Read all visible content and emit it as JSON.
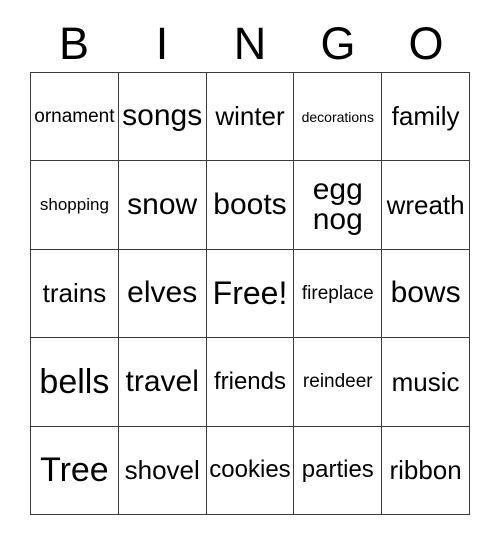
{
  "card": {
    "header": {
      "letters": [
        "B",
        "I",
        "N",
        "G",
        "O"
      ]
    },
    "grid": {
      "columns": 5,
      "rows": 5,
      "border_color": "#3a3a3a",
      "background_color": "#ffffff",
      "text_color": "#000000",
      "cells": [
        {
          "text": "ornament",
          "size": "fs-xs",
          "wrap": false
        },
        {
          "text": "songs",
          "size": "fs-l",
          "wrap": false
        },
        {
          "text": "winter",
          "size": "fs-m",
          "wrap": false
        },
        {
          "text": "decorations",
          "size": "fs-tiny",
          "wrap": false
        },
        {
          "text": "family",
          "size": "fs-m",
          "wrap": false
        },
        {
          "text": "shopping",
          "size": "fs-xxs",
          "wrap": false
        },
        {
          "text": "snow",
          "size": "fs-l",
          "wrap": false
        },
        {
          "text": "boots",
          "size": "fs-l",
          "wrap": false
        },
        {
          "text": "egg nog",
          "size": "fs-l",
          "wrap": true
        },
        {
          "text": "wreath",
          "size": "fs-m",
          "wrap": false
        },
        {
          "text": "trains",
          "size": "fs-m",
          "wrap": false
        },
        {
          "text": "elves",
          "size": "fs-l",
          "wrap": false
        },
        {
          "text": "Free!",
          "size": "fs-xl",
          "wrap": false
        },
        {
          "text": "fireplace",
          "size": "fs-xs",
          "wrap": false
        },
        {
          "text": "bows",
          "size": "fs-l",
          "wrap": false
        },
        {
          "text": "bells",
          "size": "fs-xxl",
          "wrap": false
        },
        {
          "text": "travel",
          "size": "fs-l",
          "wrap": false
        },
        {
          "text": "friends",
          "size": "fs-s",
          "wrap": false
        },
        {
          "text": "reindeer",
          "size": "fs-xs",
          "wrap": false
        },
        {
          "text": "music",
          "size": "fs-m",
          "wrap": false
        },
        {
          "text": "Tree",
          "size": "fs-xxl",
          "wrap": false
        },
        {
          "text": "shovel",
          "size": "fs-m",
          "wrap": false
        },
        {
          "text": "cookies",
          "size": "fs-s",
          "wrap": false
        },
        {
          "text": "parties",
          "size": "fs-s",
          "wrap": false
        },
        {
          "text": "ribbon",
          "size": "fs-m",
          "wrap": false
        }
      ]
    }
  }
}
